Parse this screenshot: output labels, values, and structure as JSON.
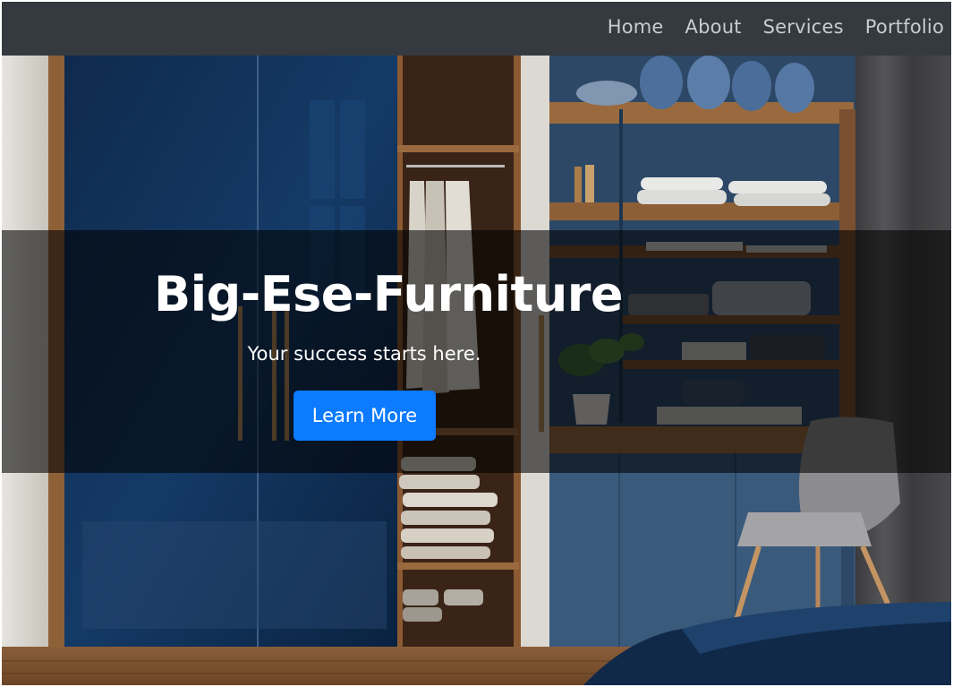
{
  "nav": {
    "items": [
      {
        "label": "Home"
      },
      {
        "label": "About"
      },
      {
        "label": "Services"
      },
      {
        "label": "Portfolio"
      }
    ]
  },
  "hero": {
    "title": "Big-Ese-Furniture",
    "subtitle": "Your success starts here.",
    "button_label": "Learn More"
  },
  "colors": {
    "navbar_bg": "#343a40",
    "nav_text": "#c9ccd0",
    "button_bg": "#0d7bff",
    "overlay": "rgba(0,0,0,0.58)"
  }
}
